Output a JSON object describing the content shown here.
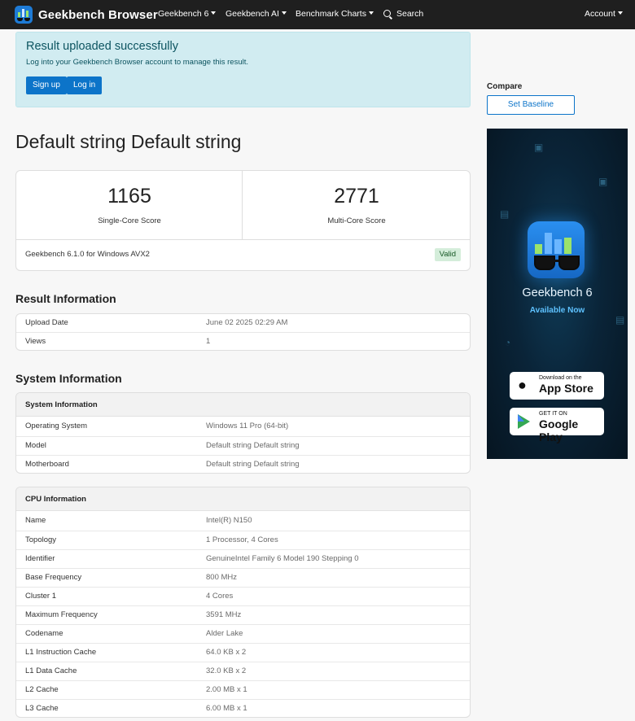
{
  "navbar": {
    "brand": "Geekbench Browser",
    "items": [
      {
        "label": "Geekbench 6"
      },
      {
        "label": "Geekbench AI"
      },
      {
        "label": "Benchmark Charts"
      }
    ],
    "search_label": "Search",
    "account_label": "Account"
  },
  "alert": {
    "title": "Result uploaded successfully",
    "text": "Log into your Geekbench Browser account to manage this result.",
    "signup_label": "Sign up",
    "login_label": "Log in"
  },
  "page_title": "Default string Default string",
  "scores": {
    "single_core_value": "1165",
    "single_core_label": "Single-Core Score",
    "multi_core_value": "2771",
    "multi_core_label": "Multi-Core Score",
    "version": "Geekbench 6.1.0 for Windows AVX2",
    "valid_badge": "Valid"
  },
  "result_info": {
    "title": "Result Information",
    "rows": [
      {
        "key": "Upload Date",
        "value": "June 02 2025 02:29 AM"
      },
      {
        "key": "Views",
        "value": "1"
      }
    ]
  },
  "system_section_title": "System Information",
  "system_info": {
    "header": "System Information",
    "rows": [
      {
        "key": "Operating System",
        "value": "Windows 11 Pro (64-bit)"
      },
      {
        "key": "Model",
        "value": "Default string Default string"
      },
      {
        "key": "Motherboard",
        "value": "Default string Default string"
      }
    ]
  },
  "cpu_info": {
    "header": "CPU Information",
    "rows": [
      {
        "key": "Name",
        "value": "Intel(R) N150"
      },
      {
        "key": "Topology",
        "value": "1 Processor, 4 Cores"
      },
      {
        "key": "Identifier",
        "value": "GenuineIntel Family 6 Model 190 Stepping 0"
      },
      {
        "key": "Base Frequency",
        "value": "800 MHz"
      },
      {
        "key": "Cluster 1",
        "value": "4 Cores"
      },
      {
        "key": "Maximum Frequency",
        "value": "3591 MHz"
      },
      {
        "key": "Codename",
        "value": "Alder Lake"
      },
      {
        "key": "L1 Instruction Cache",
        "value": "64.0 KB x 2"
      },
      {
        "key": "L1 Data Cache",
        "value": "32.0 KB x 2"
      },
      {
        "key": "L2 Cache",
        "value": "2.00 MB x 1"
      },
      {
        "key": "L3 Cache",
        "value": "6.00 MB x 1"
      }
    ]
  },
  "sidebar": {
    "compare_label": "Compare",
    "baseline_button": "Set Baseline",
    "ad": {
      "title": "Geekbench 6",
      "subtitle": "Available Now",
      "appstore_small": "Download on the",
      "appstore_big": "App Store",
      "play_small": "GET IT ON",
      "play_big": "Google Play"
    }
  },
  "colors": {
    "navbar_bg": "#1f1f1f",
    "primary": "#0c74c9",
    "alert_bg": "#d1ecf1",
    "valid_bg": "#d4edda"
  }
}
